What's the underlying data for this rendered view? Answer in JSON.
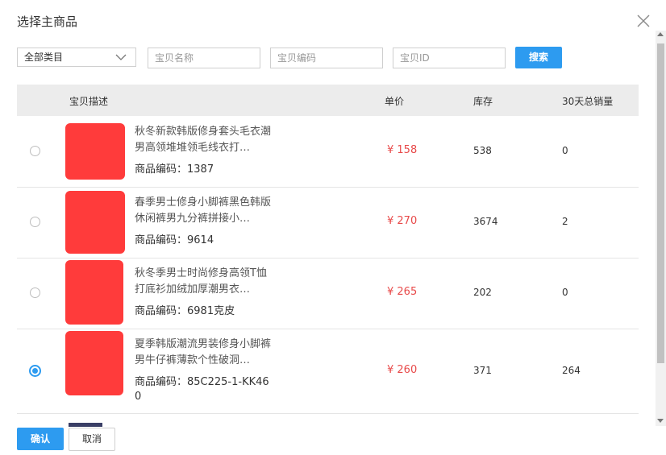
{
  "dialog": {
    "title": "选择主商品"
  },
  "filters": {
    "category_selected": "全部类目",
    "name_placeholder": "宝贝名称",
    "code_placeholder": "宝贝编码",
    "id_placeholder": "宝贝ID",
    "search_label": "搜索"
  },
  "table": {
    "headers": {
      "description": "宝贝描述",
      "price": "单价",
      "stock": "库存",
      "sales_30d": "30天总销量"
    },
    "rows": [
      {
        "title": "秋冬新款韩版修身套头毛衣潮 男高领堆堆领毛线衣打…",
        "code_text": "商品编码：1387",
        "price_text": "¥ 158",
        "stock": "538",
        "sales": "0",
        "selected": false
      },
      {
        "title": "春季男士修身小脚裤黑色韩版休闲裤男九分裤拼接小…",
        "code_text": "商品编码：9614",
        "price_text": "¥ 270",
        "stock": "3674",
        "sales": "2",
        "selected": false
      },
      {
        "title": "秋冬季男士时尚修身高领T恤打底衫加绒加厚潮男衣…",
        "code_text": "商品编码：6981克皮",
        "price_text": "¥ 265",
        "stock": "202",
        "sales": "0",
        "selected": false
      },
      {
        "title": "夏季韩版潮流男装修身小脚裤男牛仔裤薄款个性破洞…",
        "code_text": "商品编码：85C225-1-KK460",
        "price_text": "¥ 260",
        "stock": "371",
        "sales": "264",
        "selected": true
      }
    ]
  },
  "footer": {
    "confirm_label": "确认",
    "cancel_label": "取消"
  },
  "colors": {
    "accent": "#2d9bf0",
    "price": "#e84a4a",
    "redaction": "#ff3b3b"
  }
}
